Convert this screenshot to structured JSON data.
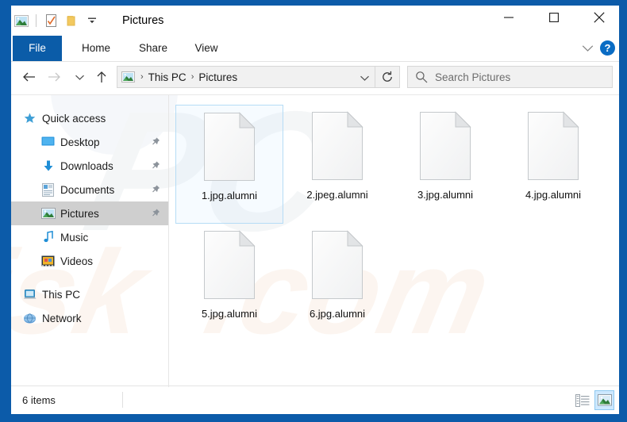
{
  "window": {
    "title": "Pictures",
    "controls": {
      "minimize": "minimize-button",
      "maximize": "maximize-button",
      "close": "close-button"
    }
  },
  "quick_access_toolbar": {
    "icons": [
      "pictures-folder-icon",
      "properties-icon",
      "new-folder-icon",
      "customize-dropdown-icon"
    ]
  },
  "ribbon": {
    "tabs": [
      {
        "label": "File",
        "active": true
      },
      {
        "label": "Home",
        "active": false
      },
      {
        "label": "Share",
        "active": false
      },
      {
        "label": "View",
        "active": false
      }
    ],
    "collapse_icon": "chevron-down-icon",
    "help_label": "?"
  },
  "address_bar": {
    "back": "back-arrow-icon",
    "forward": "forward-arrow-icon",
    "recent": "recent-locations-icon",
    "up": "up-arrow-icon",
    "breadcrumbs": [
      "This PC",
      "Pictures"
    ],
    "separator": "›",
    "dropdown_icon": "chevron-down-icon",
    "refresh_icon": "refresh-icon"
  },
  "search": {
    "icon": "search-icon",
    "placeholder": "Search Pictures"
  },
  "sidebar": {
    "items": [
      {
        "label": "Quick access",
        "icon": "star-icon",
        "indent": "top",
        "pinned": false,
        "selected": false
      },
      {
        "label": "Desktop",
        "icon": "desktop-icon",
        "indent": "1",
        "pinned": true,
        "selected": false
      },
      {
        "label": "Downloads",
        "icon": "download-icon",
        "indent": "1",
        "pinned": true,
        "selected": false
      },
      {
        "label": "Documents",
        "icon": "documents-icon",
        "indent": "1",
        "pinned": true,
        "selected": false
      },
      {
        "label": "Pictures",
        "icon": "pictures-icon",
        "indent": "1",
        "pinned": true,
        "selected": true
      },
      {
        "label": "Music",
        "icon": "music-icon",
        "indent": "1",
        "pinned": false,
        "selected": false
      },
      {
        "label": "Videos",
        "icon": "videos-icon",
        "indent": "1",
        "pinned": false,
        "selected": false
      },
      {
        "label": "This PC",
        "icon": "this-pc-icon",
        "indent": "top",
        "pinned": false,
        "selected": false
      },
      {
        "label": "Network",
        "icon": "network-icon",
        "indent": "top",
        "pinned": false,
        "selected": false
      }
    ]
  },
  "files": [
    {
      "name": "1.jpg.alumni",
      "icon": "generic-file-icon",
      "selected": true
    },
    {
      "name": "2.jpeg.alumni",
      "icon": "generic-file-icon",
      "selected": false
    },
    {
      "name": "3.jpg.alumni",
      "icon": "generic-file-icon",
      "selected": false
    },
    {
      "name": "4.jpg.alumni",
      "icon": "generic-file-icon",
      "selected": false
    },
    {
      "name": "5.jpg.alumni",
      "icon": "generic-file-icon",
      "selected": false
    },
    {
      "name": "6.jpg.alumni",
      "icon": "generic-file-icon",
      "selected": false
    }
  ],
  "status_bar": {
    "count_text": "6 items",
    "view_details_icon": "details-view-icon",
    "view_icons_icon": "large-icons-view-icon"
  },
  "watermark": {
    "text": "PCrisk.com"
  },
  "colors": {
    "window_frame": "#0c5ba9",
    "file_tab": "#0b5ca8",
    "selection": "#cde8ff",
    "nav_selected": "#cfcfcf",
    "help_badge": "#0a6cc4"
  }
}
